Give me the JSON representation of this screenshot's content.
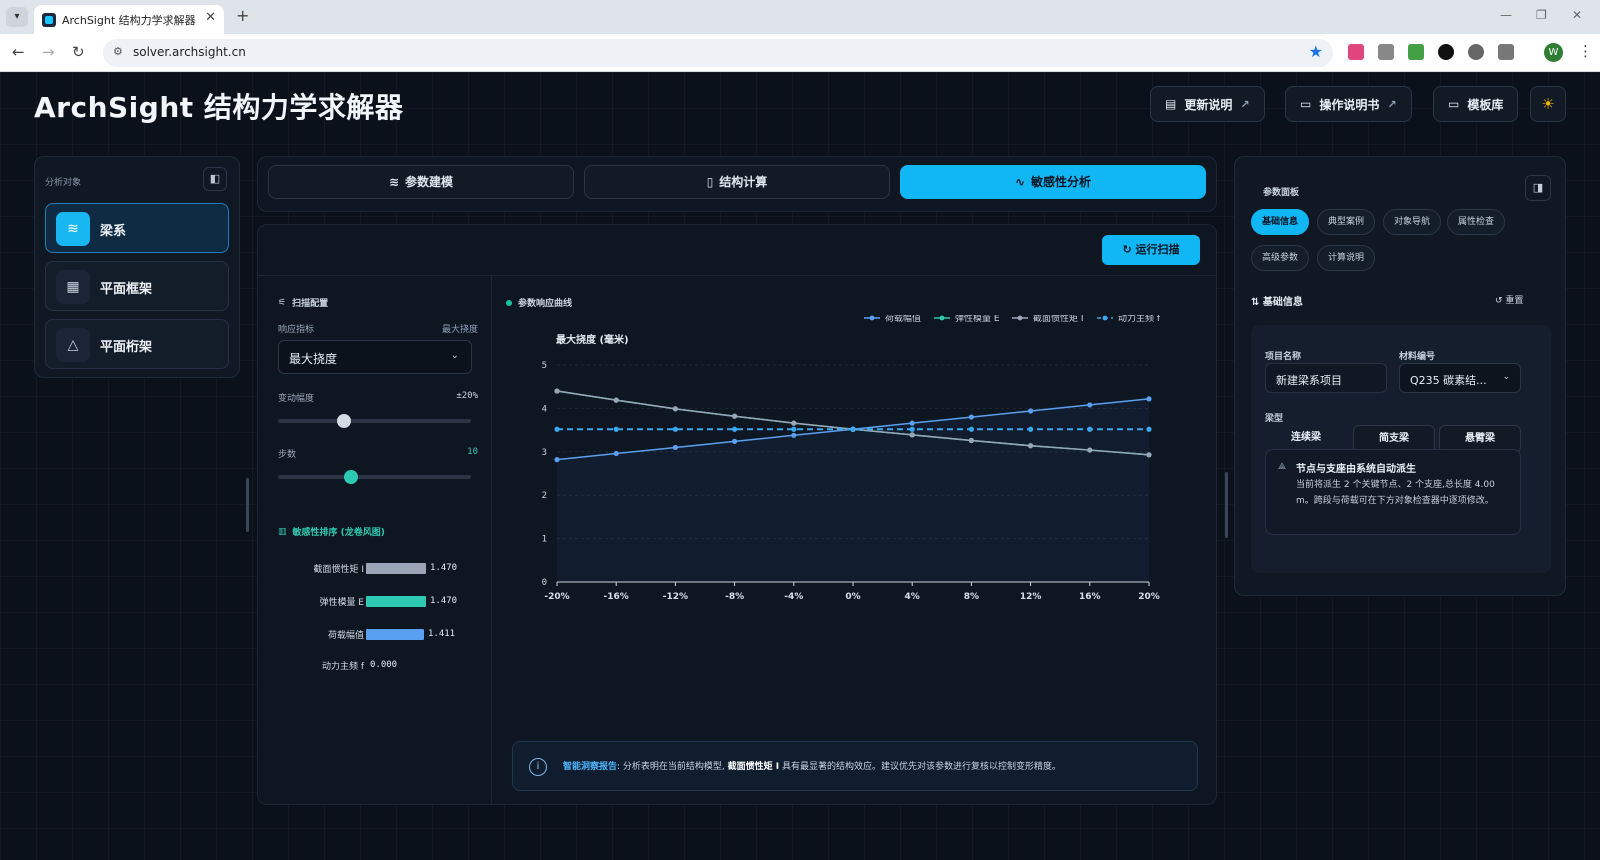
{
  "browser": {
    "tab_title": "ArchSight 结构力学求解器",
    "url": "solver.archsight.cn",
    "profile_initial": "W"
  },
  "header": {
    "title": "ArchSight 结构力学求解器",
    "buttons": {
      "changelog": "更新说明",
      "manual": "操作说明书",
      "templates": "模板库"
    }
  },
  "left_panel": {
    "label": "分析对象",
    "items": [
      {
        "label": "梁系",
        "icon": "layers-icon",
        "active": true
      },
      {
        "label": "平面框架",
        "icon": "building-icon",
        "active": false
      },
      {
        "label": "平面桁架",
        "icon": "triangle-icon",
        "active": false
      }
    ]
  },
  "mode_tabs": [
    {
      "label": "参数建模",
      "icon": "layers-icon",
      "active": false
    },
    {
      "label": "结构计算",
      "icon": "document-icon",
      "active": false
    },
    {
      "label": "敏感性分析",
      "icon": "pulse-icon",
      "active": true
    }
  ],
  "run_scan_label": "运行扫描",
  "scan_config": {
    "title": "扫描配置",
    "metric_label": "响应指标",
    "metric_value_hint": "最大挠度",
    "metric_selected": "最大挠度",
    "range_label": "变动幅度",
    "range_value": "±20%",
    "range_fraction": 0.34,
    "steps_label": "步数",
    "steps_value": "10",
    "steps_fraction": 0.38
  },
  "ranking": {
    "title": "敏感性排序 (龙卷风图)",
    "max_value": 1.47,
    "items": [
      {
        "label": "截面惯性矩 I",
        "value": 1.47,
        "display": "1.470",
        "color": "#9aa6b8"
      },
      {
        "label": "弹性模量 E",
        "value": 1.47,
        "display": "1.470",
        "color": "#2ec9b2"
      },
      {
        "label": "荷载幅值",
        "value": 1.411,
        "display": "1.411",
        "color": "#5aa0f0"
      },
      {
        "label": "动力主频 f",
        "value": 0.0,
        "display": "0.000",
        "color": "#3aa7f0"
      }
    ]
  },
  "chart_title": "参数响应曲线",
  "chart_data": {
    "type": "line",
    "ylabel": "最大挠度 (毫米)",
    "x": [
      -20,
      -16,
      -12,
      -8,
      -4,
      0,
      4,
      8,
      12,
      16,
      20
    ],
    "x_tick_labels": [
      "-20%",
      "-16%",
      "-12%",
      "-8%",
      "-4%",
      "0%",
      "4%",
      "8%",
      "12%",
      "16%",
      "20%"
    ],
    "ylim": [
      0,
      5
    ],
    "y_ticks": [
      0,
      1,
      2,
      3,
      4,
      5
    ],
    "grid": true,
    "legend": "top-right",
    "series": [
      {
        "name": "荷载幅值",
        "color": "#5aa0f0",
        "dashed": false,
        "values": [
          2.82,
          2.96,
          3.1,
          3.24,
          3.38,
          3.52,
          3.66,
          3.8,
          3.94,
          4.08,
          4.22
        ]
      },
      {
        "name": "弹性模量 E",
        "color": "#2ec9b2",
        "dashed": false,
        "values": [
          4.4,
          4.19,
          3.99,
          3.82,
          3.66,
          3.52,
          3.39,
          3.26,
          3.14,
          3.04,
          2.93
        ]
      },
      {
        "name": "截面惯性矩 I",
        "color": "#9aa6b8",
        "dashed": false,
        "values": [
          4.4,
          4.19,
          3.99,
          3.82,
          3.66,
          3.52,
          3.39,
          3.26,
          3.14,
          3.04,
          2.93
        ]
      },
      {
        "name": "动力主频 f",
        "color": "#3aa7f0",
        "dashed": true,
        "values": [
          3.52,
          3.52,
          3.52,
          3.52,
          3.52,
          3.52,
          3.52,
          3.52,
          3.52,
          3.52,
          3.52
        ]
      }
    ]
  },
  "insight": {
    "title": "智能洞察报告",
    "text1": ": 分析表明在当前结构模型,",
    "highlight": "截面惯性矩 I",
    "text2": "具有最显著的结构效应。建议优先对该参数进行复核以控制变形精度。"
  },
  "right_panel": {
    "label": "参数面板",
    "pills": [
      "基础信息",
      "典型案例",
      "对象导航",
      "属性检查",
      "高级参数",
      "计算说明"
    ],
    "section_title": "基础信息",
    "reset_label": "重置",
    "project_name_label": "项目名称",
    "project_name_value": "新建梁系项目",
    "material_label": "材料编号",
    "material_value": "Q235 碳素结...",
    "beam_type_label": "梁型",
    "beam_types": [
      "连续梁",
      "简支梁",
      "悬臂梁"
    ],
    "note_title": "节点与支座由系统自动派生",
    "note_body": "当前将派生 2 个关键节点、2 个支座,总长度 4.00 m。跨段与荷载可在下方对象检查器中逐项修改。"
  }
}
